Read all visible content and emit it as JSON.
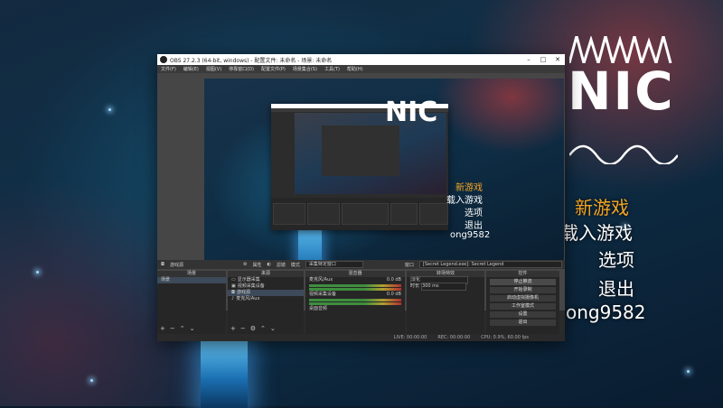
{
  "obs": {
    "title": "OBS 27.2.3 (64-bit, windows) - 配置文件: 未命名 - 场景: 未命名",
    "menu": [
      "文件(F)",
      "编辑(E)",
      "视图(V)",
      "停靠窗口(D)",
      "配置文件(P)",
      "场景集合(S)",
      "工具(T)",
      "帮助(H)"
    ],
    "source_toolbar": {
      "source_label": "游戏源",
      "properties": "属性",
      "filters": "滤镜",
      "mode_label": "模式",
      "mode_value": "采集特定窗口",
      "window_label": "窗口",
      "window_value": "[Secret Legend.exe]: Secret Legend"
    },
    "docks": {
      "scenes": {
        "header": "场景",
        "items": [
          "场景"
        ]
      },
      "sources": {
        "header": "来源",
        "items": [
          "显示器采集",
          "视频采集设备",
          "游戏源",
          "麦克风/Aux"
        ]
      },
      "mixer": {
        "header": "混音器",
        "channels": [
          {
            "name": "麦克风/Aux",
            "level": "0.0 dB"
          },
          {
            "name": "视频采集设备",
            "level": "0.0 dB"
          }
        ],
        "footer": "桌面音频"
      },
      "transitions": {
        "header": "转场特效",
        "type": "淡化",
        "duration_label": "时长",
        "duration_value": "300 ms"
      },
      "controls": {
        "header": "控件",
        "buttons": [
          "停止推流",
          "开始录制",
          "启动虚拟摄像机",
          "工作室模式",
          "设置",
          "退出"
        ]
      }
    },
    "status": {
      "live": "LIVE: 00:00:00",
      "rec": "REC: 00:00:00",
      "cpu": "CPU: 0.9%, 60.00 fps"
    }
  },
  "game": {
    "logo_text": "NIC",
    "menu": [
      "新游戏",
      "载入游戏",
      "选项",
      "退出",
      "ong9582"
    ]
  }
}
